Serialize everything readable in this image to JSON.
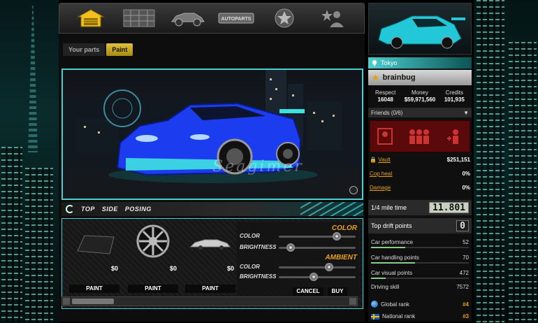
{
  "subtabs": [
    {
      "label": "Your parts"
    },
    {
      "label": "Paint"
    }
  ],
  "watermark": "Seagimer",
  "view_options": [
    "TOP",
    "SIDE",
    "POSING"
  ],
  "shop": {
    "parts": [
      {
        "price": "$0",
        "button": "PAINT"
      },
      {
        "price": "$0",
        "button": "PAINT"
      },
      {
        "price": "$0",
        "button": "PAINT"
      }
    ],
    "color_title": "COLOR",
    "ambient_title": "AMBIENT",
    "color_label": "COLOR",
    "brightness_label": "BRIGHTNESS",
    "ambient_color_label": "COLOR",
    "ambient_brightness_label": "BRIGHTNESS",
    "cancel": "CANCEL",
    "buy": "BUY"
  },
  "nav_badge": "AUTOPARTS",
  "profile": {
    "location": "Tokyo",
    "username": "brainbug",
    "stats": [
      {
        "label": "Respect",
        "value": "16048"
      },
      {
        "label": "Money",
        "value": "$59,971,560"
      },
      {
        "label": "Credits",
        "value": "101,935"
      }
    ],
    "friends": "Friends (0/6)",
    "vault_label": "Vault",
    "vault_value": "$251,151",
    "cop_heat_label": "Cop heat",
    "cop_heat_value": "0%",
    "damage_label": "Damage",
    "damage_value": "0%",
    "quarter_mile_label": "1/4 mile time",
    "quarter_mile_value": "11.801",
    "drift_label": "Top drift points",
    "drift_value": "0",
    "performance": [
      {
        "label": "Car performance",
        "value": "52",
        "level": 0.35
      },
      {
        "label": "Car handling points",
        "value": "70",
        "level": 0.45
      },
      {
        "label": "Car visual points",
        "value": "472",
        "level": 0.15
      },
      {
        "label": "Driving skill",
        "value": "7572",
        "level": 0
      }
    ],
    "global_rank_label": "Global rank",
    "global_rank_value": "#4",
    "national_rank_label": "National rank",
    "national_rank_value": "#3"
  },
  "sliders": {
    "color": 0.75,
    "brightness": 0.15,
    "ambient_color": 0.65,
    "ambient_brightness": 0.45
  },
  "colors": {
    "accent": "#4ccfd0",
    "gold": "#e8a020",
    "car_body": "#1c3cf0"
  }
}
